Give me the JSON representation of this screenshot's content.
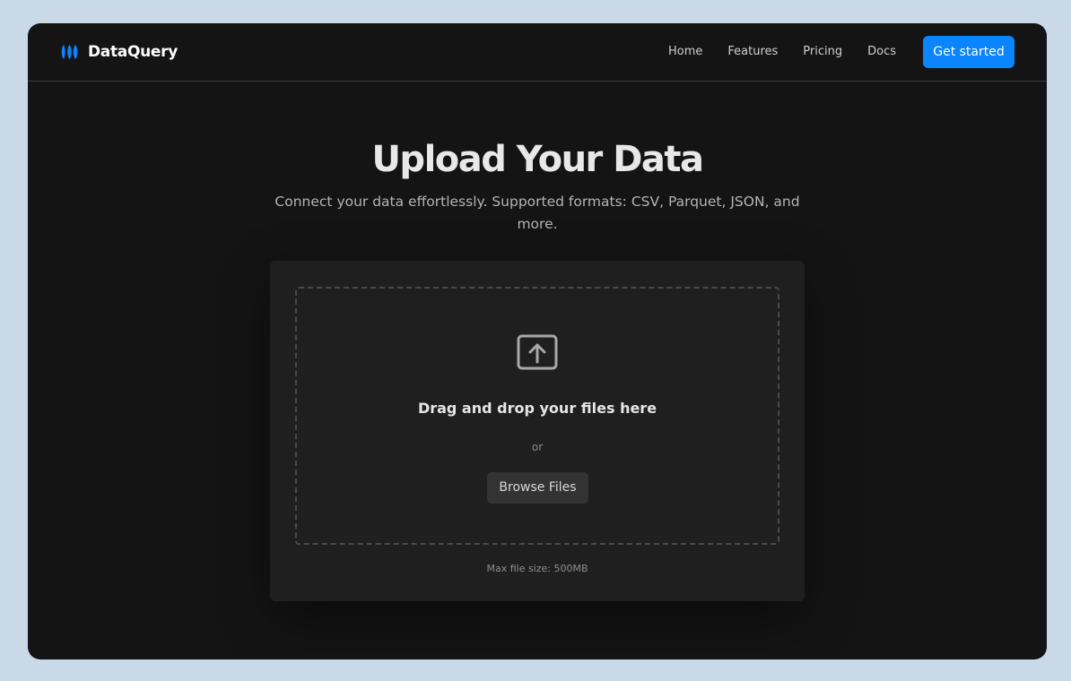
{
  "brand": {
    "name": "DataQuery",
    "logo_icon": "waves-logo-icon",
    "logo_color": "#0a84ff"
  },
  "nav": {
    "links": [
      "Home",
      "Features",
      "Pricing",
      "Docs"
    ],
    "cta_label": "Get started",
    "cta_color": "#0a84ff"
  },
  "hero": {
    "title": "Upload Your Data",
    "subtitle": "Connect your data effortlessly. Supported formats: CSV, Parquet, JSON, and more."
  },
  "upload": {
    "icon": "upload-arrow-icon",
    "drop_title": "Drag and drop your files here",
    "or_text": "or",
    "browse_label": "Browse Files",
    "max_size": "Max file size: 500MB"
  }
}
